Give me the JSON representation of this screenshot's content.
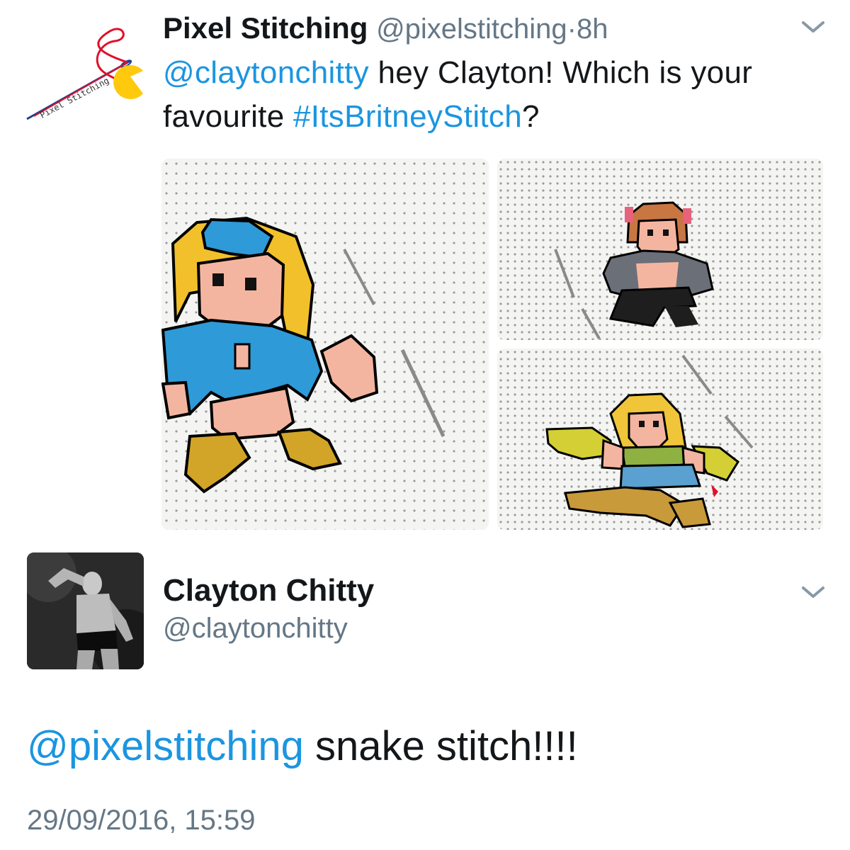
{
  "tweet": {
    "author_name": "Pixel Stitching",
    "author_handle": "@pixelstitching",
    "separator": "·",
    "time_ago": "8h",
    "logo_text": "Pixel Stitching",
    "text": {
      "mention": "@claytonchitty",
      "body": " hey Clayton! Which is your favourite ",
      "hashtag": "#ItsBritneyStitch",
      "end": "?"
    },
    "media": [
      {
        "name": "cross-stitch-blue-outfit-photo"
      },
      {
        "name": "cross-stitch-black-outfit-photo"
      },
      {
        "name": "cross-stitch-snake-outfit-photo"
      }
    ]
  },
  "reply": {
    "author_name": "Clayton Chitty",
    "author_handle": "@claytonchitty",
    "text": {
      "mention": "@pixelstitching",
      "body": " snake stitch!!!!"
    },
    "timestamp": "29/09/2016, 15:59"
  },
  "icons": {
    "more": "chevron-down-icon"
  },
  "colors": {
    "link": "#1b95e0",
    "secondary_text": "#657786",
    "primary_text": "#14171a"
  }
}
